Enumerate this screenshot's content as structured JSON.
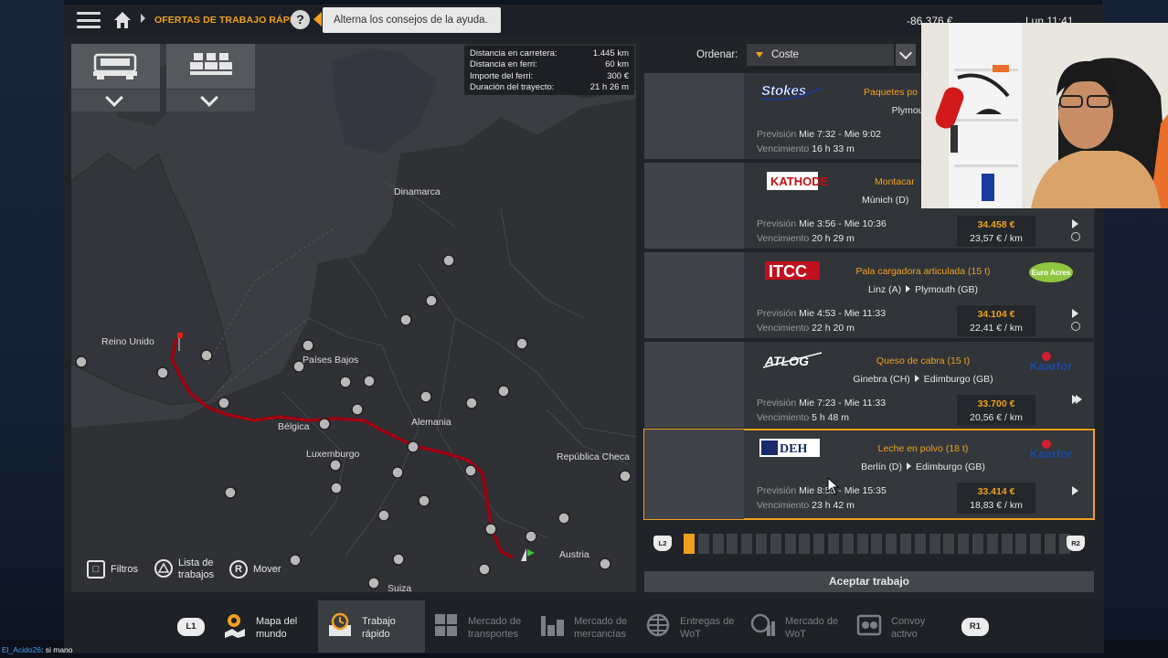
{
  "topbar": {
    "breadcrumb": "OFERTAS DE TRABAJO RÁPIDO",
    "help_symbol": "?",
    "tooltip": "Alterna los consejos de la ayuda.",
    "money": "-86.376 €",
    "clock": "Lun 11:41"
  },
  "route_info": {
    "rows": [
      {
        "label": "Distancia en carretera:",
        "value": "1.445 km"
      },
      {
        "label": "Distancia en ferri:",
        "value": "60 km"
      },
      {
        "label": "Importe del ferri:",
        "value": "300 €"
      },
      {
        "label": "Duración del trayecto:",
        "value": "21 h 26 m"
      }
    ]
  },
  "map_labels": {
    "dinamarca": "Dinamarca",
    "reino_unido": "Reino Unido",
    "paises_bajos": "Países Bajos",
    "belgica": "Bélgica",
    "alemania": "Alemania",
    "luxemburgo": "Luxemburgo",
    "republica_checa": "República Checa",
    "austria": "Austria",
    "suiza": "Suiza"
  },
  "map_controls": {
    "filters": "Filtros",
    "job_list_line1": "Lista de",
    "job_list_line2": "trabajos",
    "move_key": "R",
    "move": "Mover"
  },
  "sort": {
    "label": "Ordenar:",
    "value": "Coste"
  },
  "jobs": [
    {
      "logo": "Stokes",
      "cargo": "Paquetes po",
      "from": "",
      "to": "Plymouth (GB)",
      "forecast_label": "Previsión",
      "forecast": "Mie 7:32 - Mie 9:02",
      "expiry_label": "Vencimiento",
      "expiry": "16 h 33 m",
      "price": "",
      "price_km": ""
    },
    {
      "logo": "KATHODE",
      "cargo": "Montacar",
      "from": "Múnich (D)",
      "to": "",
      "forecast_label": "Previsión",
      "forecast": "Mie 3:56 - Mie 10:36",
      "expiry_label": "Vencimiento",
      "expiry": "20 h 29 m",
      "price": "34.458 €",
      "price_km": "23,57 € / km"
    },
    {
      "logo": "ITCC",
      "cargo": "Pala cargadora articulada (15 t)",
      "from": "Linz (A)",
      "to": "Plymouth (GB)",
      "forecast_label": "Previsión",
      "forecast": "Mie 4:53 - Mie 11:33",
      "expiry_label": "Vencimiento",
      "expiry": "22 h 20 m",
      "price": "34.104 €",
      "price_km": "22,41 € / km",
      "right_logo": "Euro Acres"
    },
    {
      "logo": "ATLOG",
      "cargo": "Queso de cabra (15 t)",
      "from": "Ginebra (CH)",
      "to": "Edimburgo (GB)",
      "forecast_label": "Previsión",
      "forecast": "Mie 7:23 - Mie 11:33",
      "expiry_label": "Vencimiento",
      "expiry": "5 h 48 m",
      "price": "33.700 €",
      "price_km": "20,56 € / km",
      "right_logo": "Kaarfor"
    },
    {
      "logo": "DEH",
      "cargo": "Leche en polvo (18 t)",
      "from": "Berlín (D)",
      "to": "Edimburgo (GB)",
      "forecast_label": "Previsión",
      "forecast": "Mie 8:55 - Mie 15:35",
      "expiry_label": "Vencimiento",
      "expiry": "23 h 42 m",
      "price": "33.414 €",
      "price_km": "18,83 € / km",
      "right_logo": "Kaarfor"
    }
  ],
  "pager": {
    "left_key": "L2",
    "right_key": "R2",
    "active_index": 0,
    "total": 27
  },
  "accept_button": "Aceptar trabajo",
  "bottom_nav": {
    "left_key": "L1",
    "right_key": "R1",
    "items": [
      {
        "line1": "Mapa del",
        "line2": "mundo"
      },
      {
        "line1": "Trabajo",
        "line2": "rápido"
      },
      {
        "line1": "Mercado de",
        "line2": "transportes"
      },
      {
        "line1": "Mercado de",
        "line2": "mercancías"
      },
      {
        "line1": "Entregas de",
        "line2": "WoT"
      },
      {
        "line1": "Mercado de",
        "line2": "WoT"
      },
      {
        "line1": "Convoy",
        "line2": "activo"
      }
    ]
  },
  "chat": {
    "user": "El_Acido26",
    "message": ": si mano"
  },
  "colors": {
    "accent": "#f0a020",
    "route": "#a00010",
    "panel": "#313438"
  }
}
